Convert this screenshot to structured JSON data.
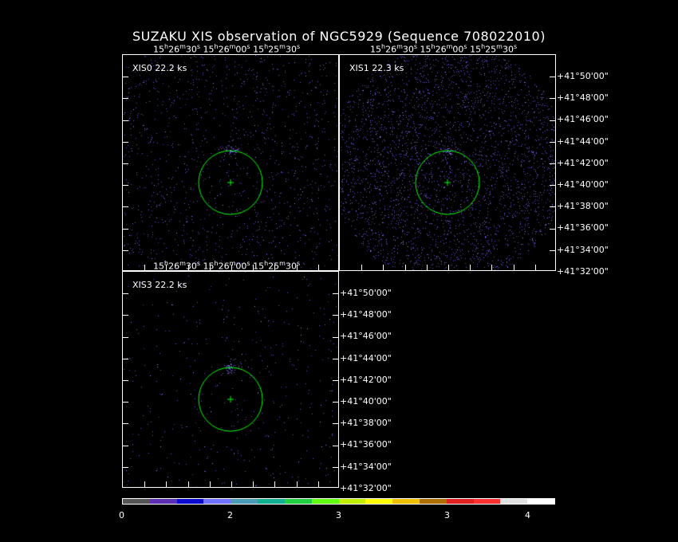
{
  "title": "SUZAKU XIS observation of NGC5929  (Sequence 708022010)",
  "ra_labels": [
    "15h26m30s",
    "15h26m00s",
    "15h25m30s"
  ],
  "dec_labels": [
    "+41°50'00\"",
    "+41°48'00\"",
    "+41°46'00\"",
    "+41°44'00\"",
    "+41°42'00\"",
    "+41°40'00\"",
    "+41°38'00\"",
    "+41°36'00\"",
    "+41°34'00\"",
    "+41°32'00\""
  ],
  "panels": [
    {
      "label": "XIS0 22.2 ks",
      "density": 0.35,
      "region_color": "#00ff00"
    },
    {
      "label": "XIS1 22.3 ks",
      "density": 1.0,
      "region_color": "#00ff00"
    },
    {
      "label": "XIS3 22.2 ks",
      "density": 0.33,
      "region_color": "#00ff00"
    }
  ],
  "colorbar": {
    "colors": [
      "#555555",
      "#5b2fb0",
      "#0a0ad0",
      "#7070ff",
      "#4a9bb5",
      "#10b090",
      "#20d040",
      "#60ff10",
      "#c0f000",
      "#ffff00",
      "#f0c000",
      "#b07000",
      "#e02020",
      "#ff3030",
      "#e0e0e0",
      "#ffffff"
    ],
    "labels": [
      "0",
      "2",
      "3",
      "3",
      "4"
    ]
  }
}
